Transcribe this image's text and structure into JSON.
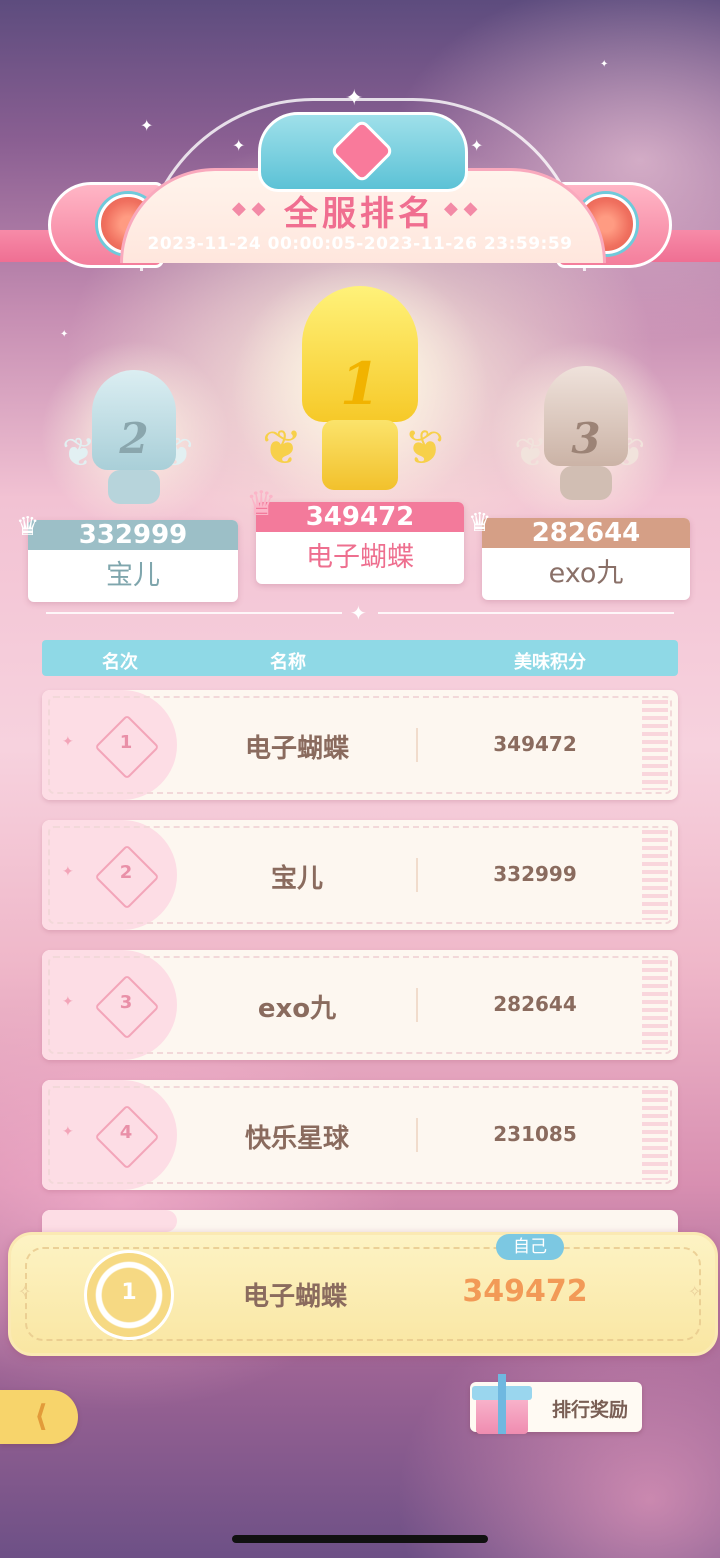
{
  "banner": {
    "title": "全服排名",
    "date_range": "2023-11-24 00:00:05-2023-11-26 23:59:59"
  },
  "podium": {
    "first": {
      "rank": "1",
      "score": "349472",
      "name": "电子蝴蝶"
    },
    "second": {
      "rank": "2",
      "score": "332999",
      "name": "宝儿"
    },
    "third": {
      "rank": "3",
      "score": "282644",
      "name": "exo九"
    }
  },
  "table": {
    "headers": {
      "rank": "名次",
      "name": "名称",
      "score": "美味积分"
    },
    "rows": [
      {
        "rank": "1",
        "name": "电子蝴蝶",
        "score": "349472"
      },
      {
        "rank": "2",
        "name": "宝儿",
        "score": "332999"
      },
      {
        "rank": "3",
        "name": "exo九",
        "score": "282644"
      },
      {
        "rank": "4",
        "name": "快乐星球",
        "score": "231085"
      }
    ]
  },
  "self": {
    "tag": "自己",
    "rank": "1",
    "name": "电子蝴蝶",
    "score": "349472"
  },
  "reward_button": {
    "label": "排行奖励"
  },
  "icons": {
    "back": "back-arrow-icon",
    "gift": "gift-icon",
    "crown": "crown-icon",
    "trophy": "trophy-icon"
  },
  "colors": {
    "gold": "#f7d04a",
    "silver": "#9bc3cd",
    "bronze": "#d59f86",
    "first_score_bar": "#f37a9b",
    "score_highlight": "#f29a57",
    "header_bg": "#8fd9e6"
  }
}
